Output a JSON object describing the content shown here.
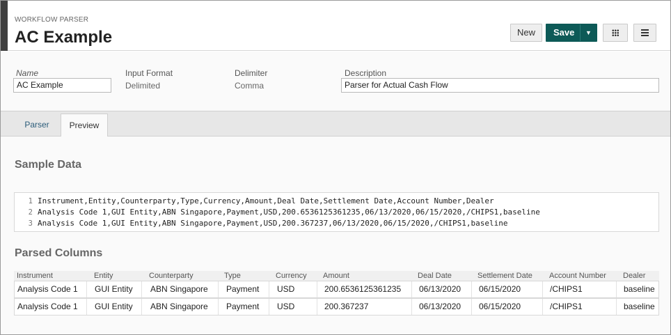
{
  "header": {
    "eyebrow": "WORKFLOW PARSER",
    "title": "AC Example",
    "new_label": "New",
    "save_label": "Save"
  },
  "props": {
    "name_label": "Name",
    "name_value": "AC Example",
    "input_format_label": "Input Format",
    "input_format_value": "Delimited",
    "delimiter_label": "Delimiter",
    "delimiter_value": "Comma",
    "description_label": "Description",
    "description_value": "Parser for Actual Cash Flow"
  },
  "tabs": [
    {
      "label": "Parser"
    },
    {
      "label": "Preview"
    }
  ],
  "sample": {
    "title": "Sample Data",
    "lines": [
      {
        "num": "1",
        "text": "Instrument,Entity,Counterparty,Type,Currency,Amount,Deal Date,Settlement Date,Account Number,Dealer"
      },
      {
        "num": "2",
        "text": "Analysis Code 1,GUI Entity,ABN Singapore,Payment,USD,200.6536125361235,06/13/2020,06/15/2020,/CHIPS1,baseline"
      },
      {
        "num": "3",
        "text": "Analysis Code 1,GUI Entity,ABN Singapore,Payment,USD,200.367237,06/13/2020,06/15/2020,/CHIPS1,baseline"
      }
    ]
  },
  "parsed": {
    "title": "Parsed Columns",
    "headers": [
      "Instrument",
      "Entity",
      "Counterparty",
      "Type",
      "Currency",
      "Amount",
      "Deal Date",
      "Settlement Date",
      "Account Number",
      "Dealer"
    ],
    "rows": [
      [
        "Analysis Code 1",
        "GUI Entity",
        "ABN Singapore",
        "Payment",
        "USD",
        "200.6536125361235",
        "06/13/2020",
        "06/15/2020",
        "/CHIPS1",
        "baseline"
      ],
      [
        "Analysis Code 1",
        "GUI Entity",
        "ABN Singapore",
        "Payment",
        "USD",
        "200.367237",
        "06/13/2020",
        "06/15/2020",
        "/CHIPS1",
        "baseline"
      ]
    ]
  },
  "colors": {
    "save_button": "#0d5a57",
    "tab_link": "#2b5c7a"
  }
}
